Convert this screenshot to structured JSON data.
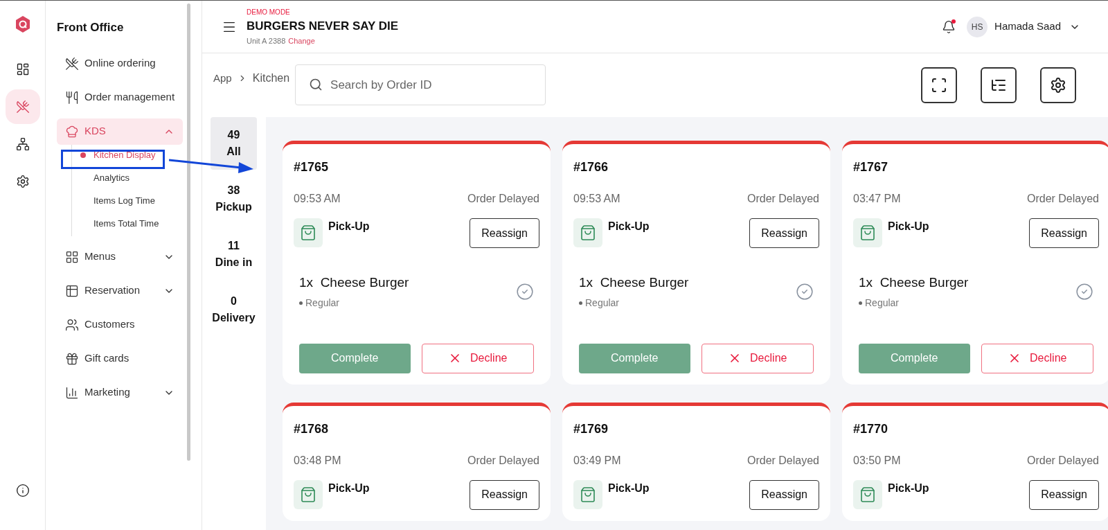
{
  "rail": [
    {
      "selected": false
    },
    {
      "selected": true
    },
    {
      "selected": false
    },
    {
      "selected": false
    },
    {
      "selected": false
    }
  ],
  "sidebar": {
    "title": "Front Office",
    "items": [
      {
        "label": "Online ordering",
        "expandable": false,
        "expanded": false,
        "selected": false
      },
      {
        "label": "Order management",
        "expandable": false,
        "expanded": false,
        "selected": false
      },
      {
        "label": "KDS",
        "expandable": true,
        "expanded": true,
        "selected": true,
        "children": [
          {
            "label": "Kitchen Display",
            "selected": true
          },
          {
            "label": "Analytics",
            "selected": false
          },
          {
            "label": "Items Log Time",
            "selected": false
          },
          {
            "label": "Items Total Time",
            "selected": false
          }
        ]
      },
      {
        "label": "Menus",
        "expandable": true,
        "expanded": false,
        "selected": false
      },
      {
        "label": "Reservation",
        "expandable": true,
        "expanded": false,
        "selected": false
      },
      {
        "label": "Customers",
        "expandable": false,
        "expanded": false,
        "selected": false
      },
      {
        "label": "Gift cards",
        "expandable": false,
        "expanded": false,
        "selected": false
      },
      {
        "label": "Marketing",
        "expandable": true,
        "expanded": false,
        "selected": false
      }
    ]
  },
  "header": {
    "mode": "DEMO MODE",
    "restaurant": "BURGERS NEVER SAY DIE",
    "unit": "Unit A 2388",
    "change_link": "Change",
    "notification": true,
    "user_initials": "HS",
    "user_name": "Hamada Saad"
  },
  "breadcrumb": [
    "App",
    "Kitchen"
  ],
  "search": {
    "placeholder": "Search by Order ID"
  },
  "filters": [
    {
      "count": "49",
      "label": "All",
      "selected": true
    },
    {
      "count": "38",
      "label": "Pickup",
      "selected": false
    },
    {
      "count": "11",
      "label": "Dine in",
      "selected": false
    },
    {
      "count": "0",
      "label": "Delivery",
      "selected": false
    }
  ],
  "orders": [
    {
      "number": "#1765",
      "time": "09:53 AM",
      "status": "Order Delayed",
      "type": "Pick-Up",
      "reassign": "Reassign",
      "items": [
        {
          "qty": "1x",
          "name": "Cheese Burger",
          "option": "Regular",
          "done": false
        }
      ],
      "complete": "Complete",
      "decline": "Decline"
    },
    {
      "number": "#1766",
      "time": "09:53 AM",
      "status": "Order Delayed",
      "type": "Pick-Up",
      "reassign": "Reassign",
      "items": [
        {
          "qty": "1x",
          "name": "Cheese Burger",
          "option": "Regular",
          "done": false
        }
      ],
      "complete": "Complete",
      "decline": "Decline"
    },
    {
      "number": "#1767",
      "time": "03:47 PM",
      "status": "Order Delayed",
      "type": "Pick-Up",
      "reassign": "Reassign",
      "items": [
        {
          "qty": "1x",
          "name": "Cheese Burger",
          "option": "Regular",
          "done": false
        }
      ],
      "complete": "Complete",
      "decline": "Decline"
    },
    {
      "number": "#1768",
      "time": "03:48 PM",
      "status": "Order Delayed",
      "type": "Pick-Up",
      "reassign": "Reassign"
    },
    {
      "number": "#1769",
      "time": "03:49 PM",
      "status": "Order Delayed",
      "type": "Pick-Up",
      "reassign": "Reassign"
    },
    {
      "number": "#1770",
      "time": "03:50 PM",
      "status": "Order Delayed",
      "type": "Pick-Up",
      "reassign": "Reassign"
    }
  ]
}
